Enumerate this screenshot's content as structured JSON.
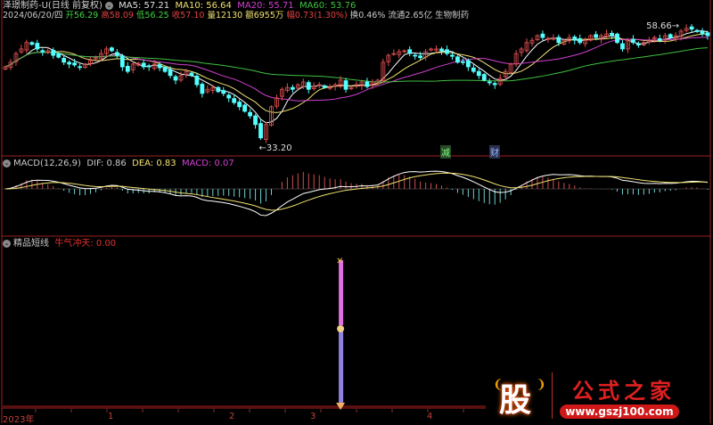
{
  "header": {
    "title": "泽璟制药-U(日线 前复权)",
    "ma5": "MA5: 57.21",
    "ma10": "MA10: 56.64",
    "ma20": "MA20: 55.71",
    "ma60": "MA60: 53.76",
    "date": "2024/06/20/四",
    "open": "开56.29",
    "high": "高58.09",
    "low": "低56.25",
    "close": "收57.10",
    "volume": "量12130",
    "amount": "额6955万",
    "change": "幅0.73(1.30%)",
    "turnover": "换0.46%",
    "float": "流通2.65亿",
    "industry": "生物制药"
  },
  "macd_header": {
    "name": "MACD(12,26,9)",
    "dif": "DIF: 0.86",
    "dea": "DEA: 0.83",
    "macd": "MACD: 0.07"
  },
  "ind_header": {
    "name": "精品短线",
    "label": "牛气冲天: 0.00"
  },
  "markers": {
    "low": "33.20",
    "high": "58.66",
    "sig1": "减",
    "sig2": "财"
  },
  "axis": [
    "2023年",
    "1",
    "2",
    "3",
    "4"
  ],
  "logo": {
    "char": "股",
    "name": "公式之家",
    "url": "www.gszj100.com"
  },
  "colors": {
    "up": "#e05050",
    "down": "#54ffff",
    "ma5": "#ffffff",
    "ma10": "#f0e070",
    "ma20": "#d040d0",
    "ma60": "#40c040",
    "border": "#a02020"
  },
  "chart_data": {
    "type": "candlestick",
    "title": "泽璟制药-U 日线",
    "series": [
      {
        "name": "close",
        "values": [
          50.3,
          51.3,
          53.2,
          54.2,
          55.6,
          55.2,
          54.2,
          53.6,
          53.8,
          52.8,
          52.4,
          51.3,
          50.9,
          50.7,
          50.3,
          50.9,
          51.7,
          52.3,
          53.2,
          54.2,
          53.8,
          52.8,
          50.3,
          49.3,
          50.9,
          51.1,
          50.3,
          50.3,
          50.9,
          50.1,
          49.3,
          48.4,
          47.4,
          48.4,
          49.3,
          48.4,
          46.4,
          44.5,
          45.4,
          45.8,
          44.9,
          44.5,
          43.5,
          42.5,
          41.6,
          40.6,
          39.6,
          37.7,
          34.8,
          37.7,
          41.6,
          43.5,
          45.4,
          45.8,
          45.4,
          46.4,
          47.0,
          45.4,
          46.0,
          46.4,
          45.8,
          45.8,
          46.4,
          47.4,
          45.4,
          45.8,
          46.4,
          47.0,
          46.0,
          47.0,
          47.4,
          51.3,
          52.8,
          53.2,
          53.6,
          53.8,
          53.2,
          52.8,
          52.3,
          53.6,
          54.2,
          54.2,
          53.8,
          53.2,
          52.6,
          51.3,
          51.3,
          50.3,
          49.3,
          48.4,
          47.4,
          46.8,
          46.4,
          47.8,
          49.3,
          50.9,
          53.2,
          54.2,
          55.6,
          56.1,
          57.1,
          56.7,
          56.5,
          56.5,
          55.6,
          56.1,
          56.7,
          56.1,
          55.6,
          56.1,
          57.1,
          56.7,
          57.1,
          57.5,
          57.1,
          55.6,
          54.2,
          56.1,
          55.6,
          55.2,
          55.6,
          56.1,
          56.7,
          56.1,
          57.1,
          56.7,
          57.1,
          58.1,
          58.66,
          58.5,
          58.0,
          57.5,
          57.1
        ]
      }
    ],
    "ylim": [
      33.2,
      58.66
    ],
    "signal_bar_index": 63
  }
}
